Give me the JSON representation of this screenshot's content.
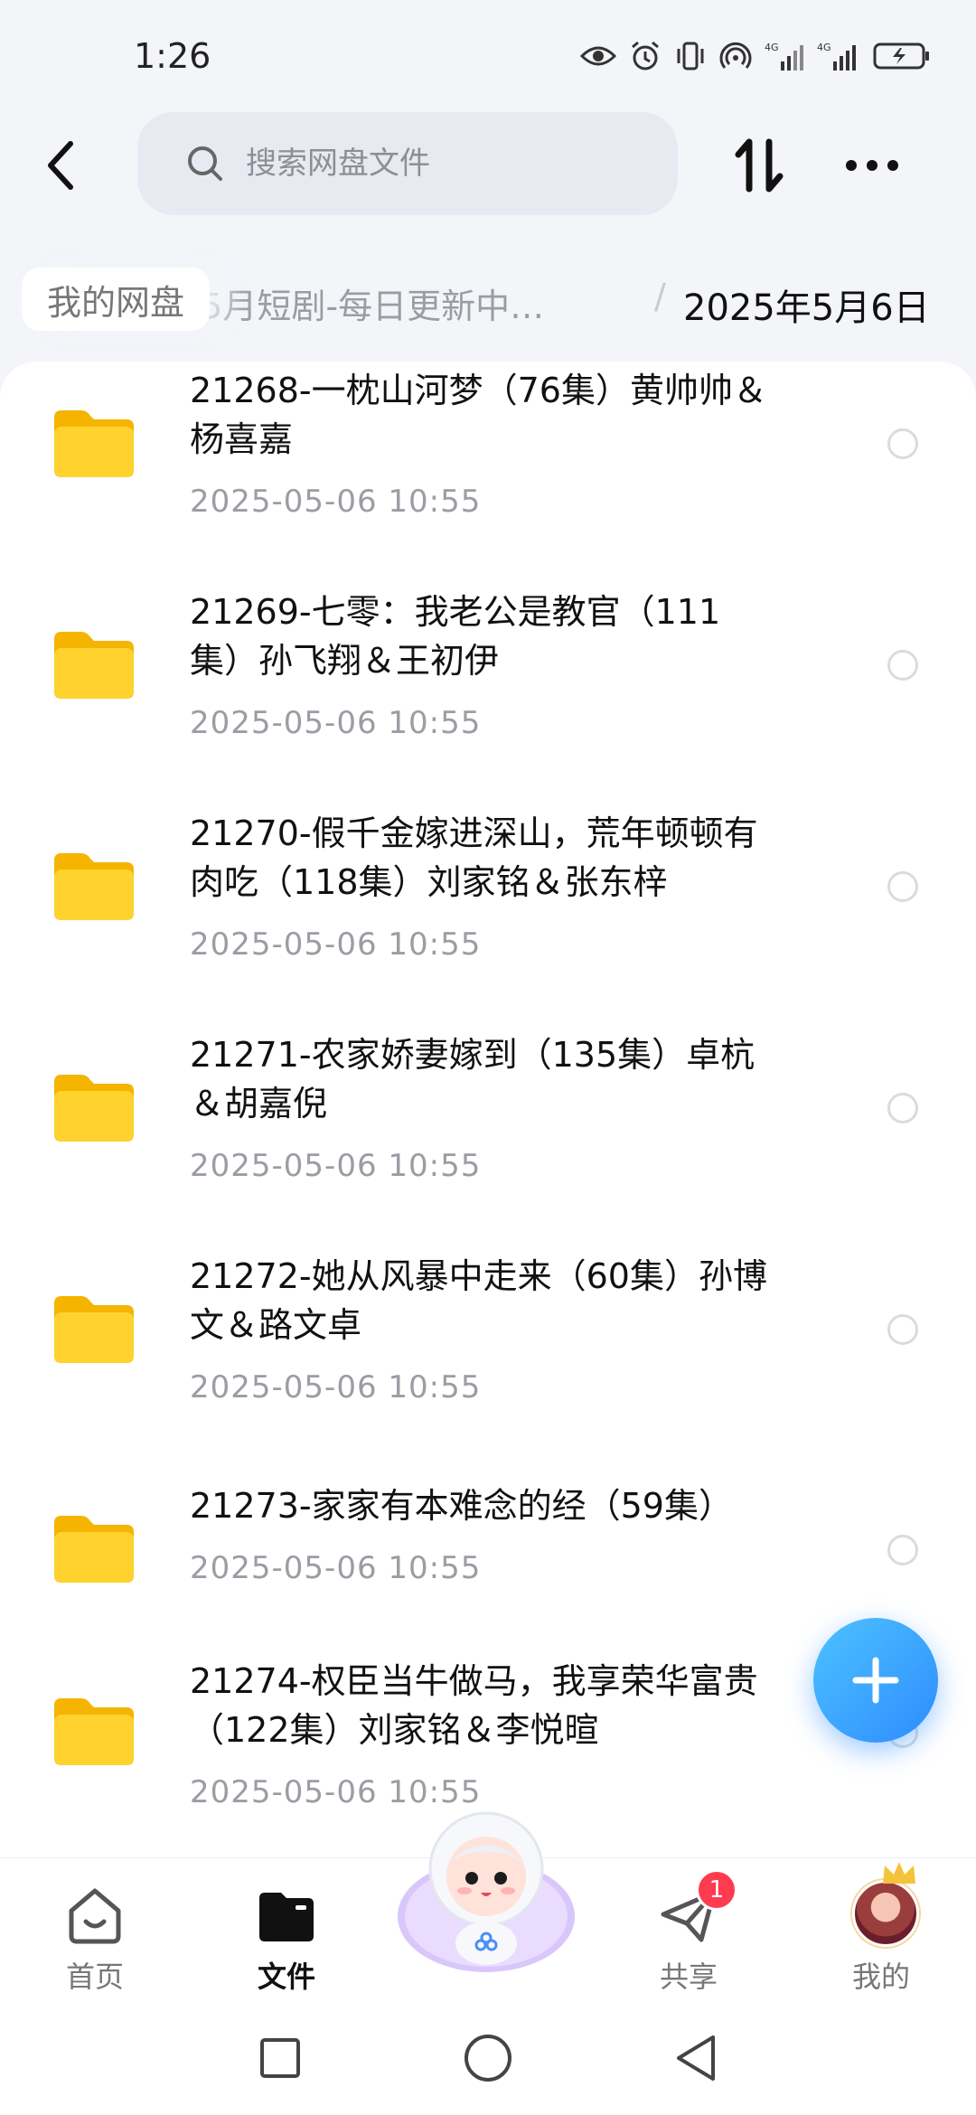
{
  "status_bar": {
    "time": "1:26"
  },
  "header": {
    "search_placeholder": "搜索网盘文件"
  },
  "breadcrumb": {
    "root": "我的网盘",
    "middle": "5年5月短剧-每日更新中…",
    "separator": "/",
    "current": "2025年5月6日"
  },
  "files": [
    {
      "name_line1": "21268-一枕山河梦（76集）黄帅帅＆",
      "name_line2": "杨喜嘉",
      "date": "2025-05-06  10:55"
    },
    {
      "name_line1": "21269-七零：我老公是教官（111",
      "name_line2": "集）孙飞翔＆王初伊",
      "date": "2025-05-06  10:55"
    },
    {
      "name_line1": "21270-假千金嫁进深山，荒年顿顿有",
      "name_line2": "肉吃（118集）刘家铭＆张东梓",
      "date": "2025-05-06  10:55"
    },
    {
      "name_line1": "21271-农家娇妻嫁到（135集）卓杭",
      "name_line2": "＆胡嘉倪",
      "date": "2025-05-06  10:55"
    },
    {
      "name_line1": "21272-她从风暴中走来（60集）孙博",
      "name_line2": "文＆路文卓",
      "date": "2025-05-06  10:55"
    },
    {
      "name_line1": "21273-家家有本难念的经（59集）",
      "name_line2": "",
      "date": "2025-05-06  10:55"
    },
    {
      "name_line1": "21274-权臣当牛做马，我享荣华富贵",
      "name_line2": "（122集）刘家铭＆李悦暄",
      "date": "2025-05-06  10:55"
    }
  ],
  "bottom_nav": {
    "home": "首页",
    "files": "文件",
    "share": "共享",
    "share_badge": "1",
    "mine": "我的"
  },
  "colors": {
    "accent": "#2d8cff",
    "folder": "#ffd22e",
    "badge": "#ff3b4f"
  },
  "icons": [
    "back-icon",
    "search-icon",
    "sort-icon",
    "more-icon",
    "folder-icon",
    "plus-icon",
    "home-icon",
    "files-icon",
    "share-icon",
    "avatar",
    "square-icon",
    "circle-icon",
    "triangle-icon"
  ]
}
